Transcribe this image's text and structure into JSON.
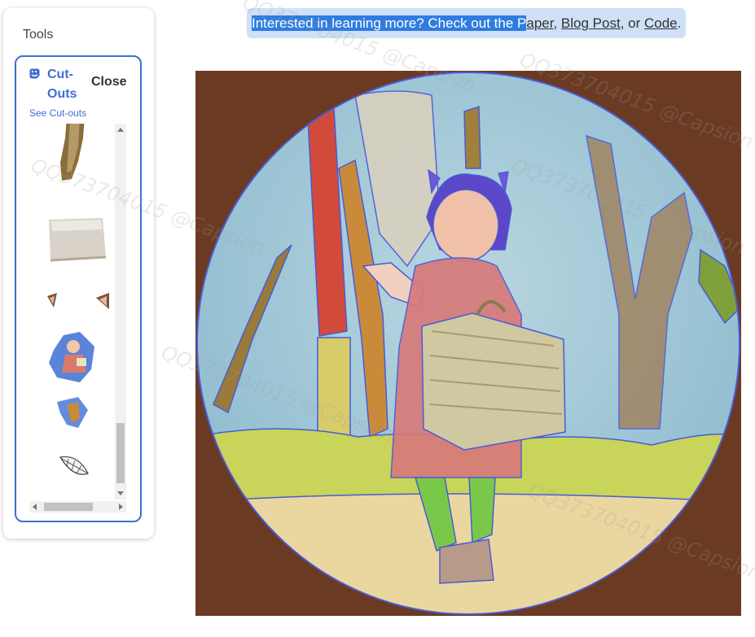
{
  "tools": {
    "title": "Tools",
    "cutouts_heading": "Cut-Outs",
    "close_label": "Close",
    "see_cutouts_label": "See Cut-outs"
  },
  "banner": {
    "prefix_selected": "Interested in learning more? Check out the P",
    "paper_label_selected": "P",
    "paper_label_rest": "aper",
    "sep1": ", ",
    "blog_label": "Blog Post",
    "sep2": ", or ",
    "code_label": "Code",
    "suffix": "."
  },
  "cutout_items": [
    "stick-cutout",
    "box-cutout",
    "ears-cutout",
    "child-cutout",
    "leaf-cutout",
    "feather-cutout"
  ],
  "watermark": {
    "text": "QQ373704015 @Capsion"
  },
  "colors": {
    "accent": "#3d6fd4",
    "banner_bg": "#cfe0f7",
    "selection": "#2f7ce0",
    "mask_brown": "#6b3a22",
    "sky_blue": "#9cc3d3"
  }
}
